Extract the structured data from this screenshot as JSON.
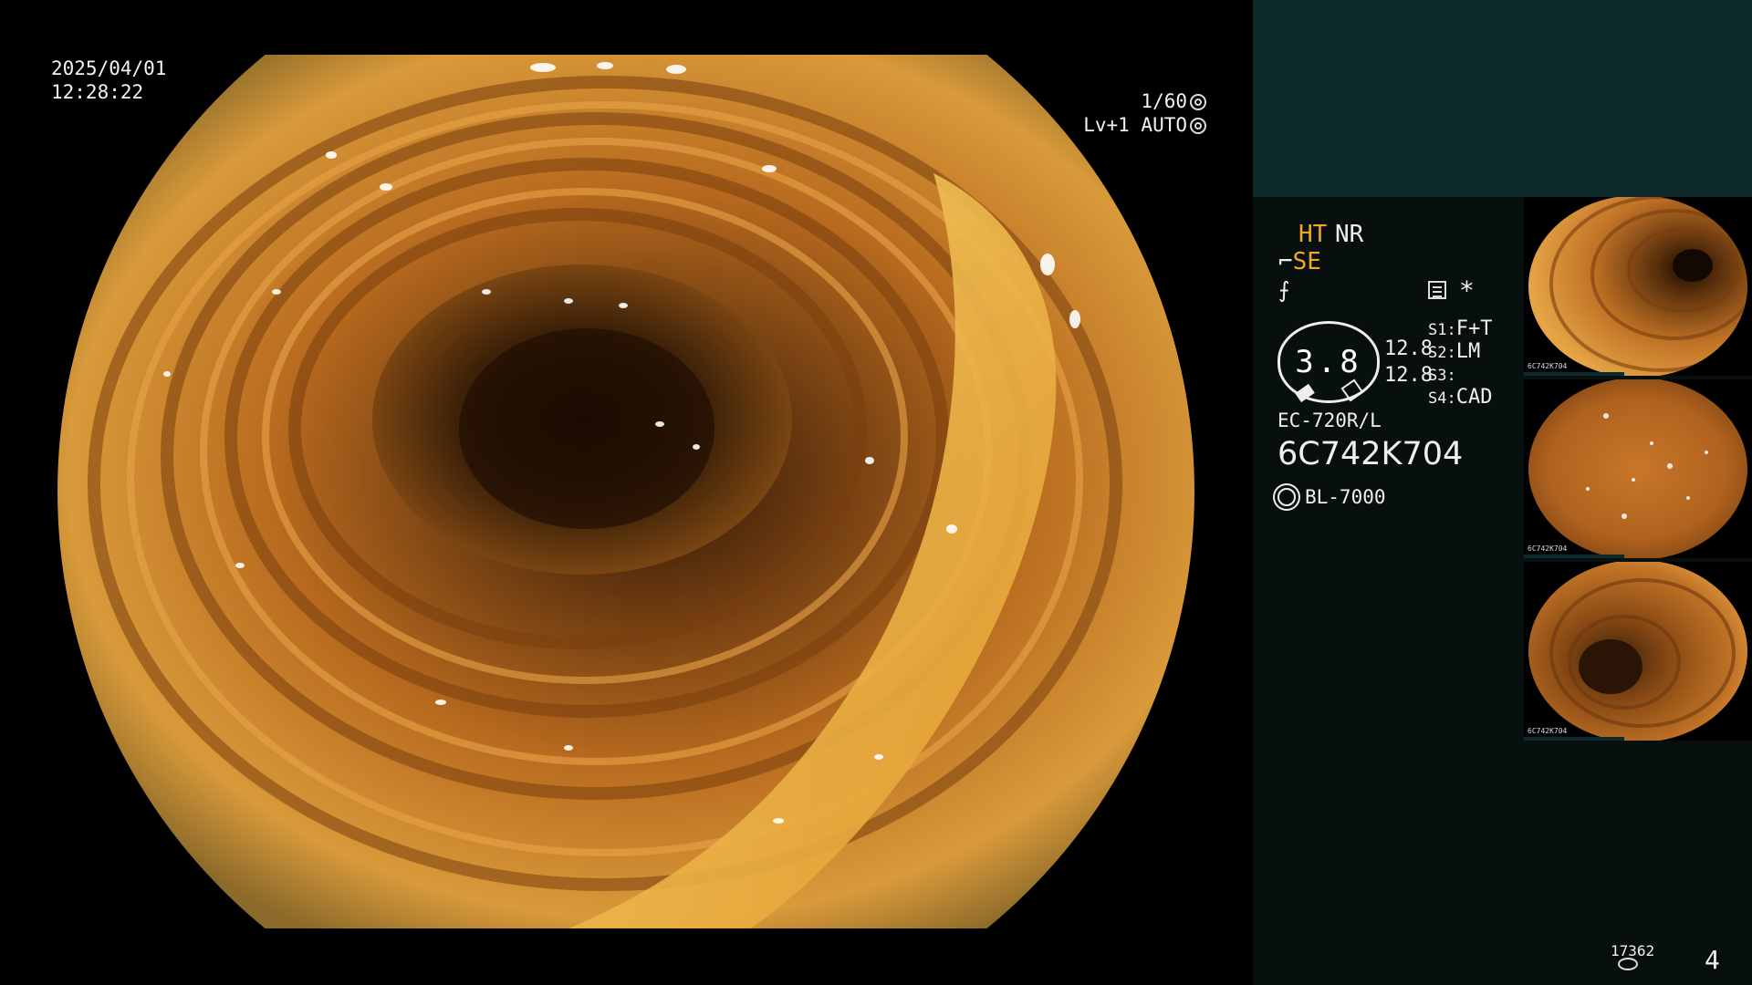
{
  "scope": {
    "date": "2025/04/01",
    "time": "12:28:22",
    "shutter": "1/60",
    "level": "Lv+1",
    "iris": "AUTO"
  },
  "panel": {
    "ht": "HT",
    "nr": "NR",
    "se": "SE",
    "sharp_symbol": "⨍",
    "star": "*",
    "gauge_value": "3.8",
    "gauge_side_1": "12.8",
    "gauge_side_2": "12.8",
    "s1_key": "S1:",
    "s1_value": "F+T",
    "s2_key": "S2:",
    "s2_value": "LM",
    "s3_key": "S3:",
    "s3_value": "",
    "s4_key": "S4:",
    "s4_value": "CAD",
    "scope_model": "EC-720R/L",
    "scope_serial": "6C742K704",
    "light_source": "BL-7000",
    "storage_count": "17362",
    "page_number": "4"
  },
  "thumbnails": [
    {
      "label": "6C742K704"
    },
    {
      "label": "6C742K704"
    },
    {
      "label": "6C742K704"
    }
  ],
  "colors": {
    "accent_orange": "#f5a623",
    "panel_top": "#0e2929",
    "panel_bg": "#07100f"
  }
}
